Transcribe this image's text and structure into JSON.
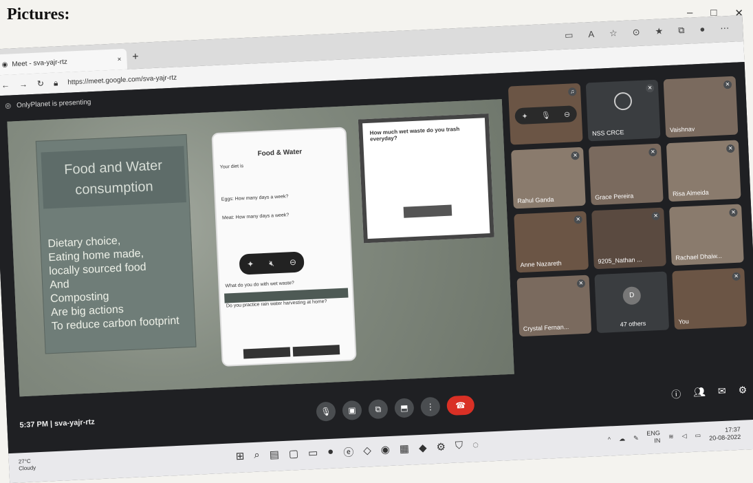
{
  "heading": "Pictures:",
  "window_controls": {
    "minimize": "–",
    "maximize": "□",
    "close": "✕"
  },
  "browser": {
    "tab_title": "Meet - sva-yajr-rtz",
    "tab_close": "×",
    "new_tab": "+",
    "url": "https://meet.google.com/sva-yajr-rtz",
    "nav": {
      "back": "←",
      "forward": "→",
      "refresh": "↻"
    }
  },
  "meet": {
    "presenting": "OnlyPlanet is presenting",
    "slide": {
      "title_line1": "Food and Water",
      "title_line2": "consumption",
      "body": [
        "Dietary choice,",
        "Eating home made,",
        "locally sourced food",
        "And",
        "Composting",
        "Are big actions",
        "To reduce carbon footprint"
      ],
      "phone_title": "Food & Water",
      "phone_rows": [
        "Your diet is",
        "Eggs: How many days a week?",
        "Meat: How many days a week?",
        "What do you do with wet waste?",
        "Do you practice rain water harvesting at home?"
      ],
      "dialog_question": "How much wet waste do you trash everyday?"
    },
    "participants": [
      {
        "name": "",
        "style": "p1"
      },
      {
        "name": "NSS CRCE",
        "style": ""
      },
      {
        "name": "Vaishnav",
        "style": "p2"
      },
      {
        "name": "Rahul Ganda",
        "style": "p3"
      },
      {
        "name": "Grace Pereira",
        "style": "p2"
      },
      {
        "name": "Risa Almeida",
        "style": "p3"
      },
      {
        "name": "Anne Nazareth",
        "style": "p1"
      },
      {
        "name": "9205_Nathan ...",
        "style": "p4"
      },
      {
        "name": "Rachael Dhaiw...",
        "style": "p3"
      },
      {
        "name": "Crystal Fernan...",
        "style": "p2"
      },
      {
        "name": "47 others",
        "style": ""
      },
      {
        "name": "You",
        "style": "p1"
      }
    ],
    "others_avatar": "D",
    "meeting_info": "5:37 PM  |  sva-yajr-rtz"
  },
  "taskbar": {
    "weather_temp": "27°C",
    "weather_desc": "Cloudy",
    "lang_line1": "ENG",
    "lang_line2": "IN",
    "time": "17:37",
    "date": "20-08-2022"
  }
}
